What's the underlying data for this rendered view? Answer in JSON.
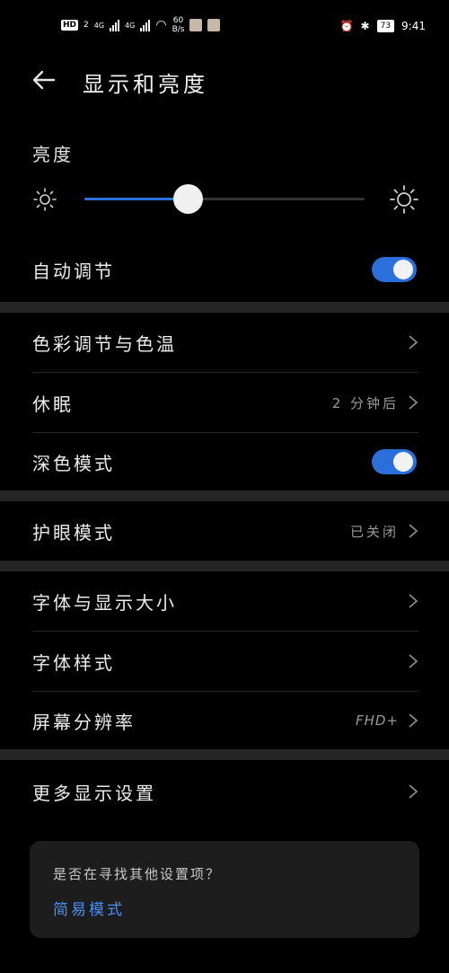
{
  "status_bar": {
    "hd": "HD",
    "sim1": "2",
    "net1": "4G",
    "net2": "4G",
    "speed_value": "60",
    "speed_unit": "B/s",
    "battery": "73",
    "time": "9:41"
  },
  "header": {
    "title": "显示和亮度"
  },
  "brightness": {
    "label": "亮度",
    "level_percent": 37
  },
  "auto_adjust": {
    "label": "自动调节",
    "on": true
  },
  "color_temp": {
    "label": "色彩调节与色温"
  },
  "sleep": {
    "label": "休眠",
    "value": "2 分钟后"
  },
  "dark_mode": {
    "label": "深色模式",
    "on": true
  },
  "eye_comfort": {
    "label": "护眼模式",
    "value": "已关闭"
  },
  "font_size": {
    "label": "字体与显示大小"
  },
  "font_style": {
    "label": "字体样式"
  },
  "resolution": {
    "label": "屏幕分辨率",
    "value": "FHD+"
  },
  "more_display": {
    "label": "更多显示设置"
  },
  "suggestion": {
    "question": "是否在寻找其他设置项？",
    "link": "简易模式"
  },
  "colors": {
    "accent": "#2a6fdb",
    "link": "#4b8ff0"
  }
}
